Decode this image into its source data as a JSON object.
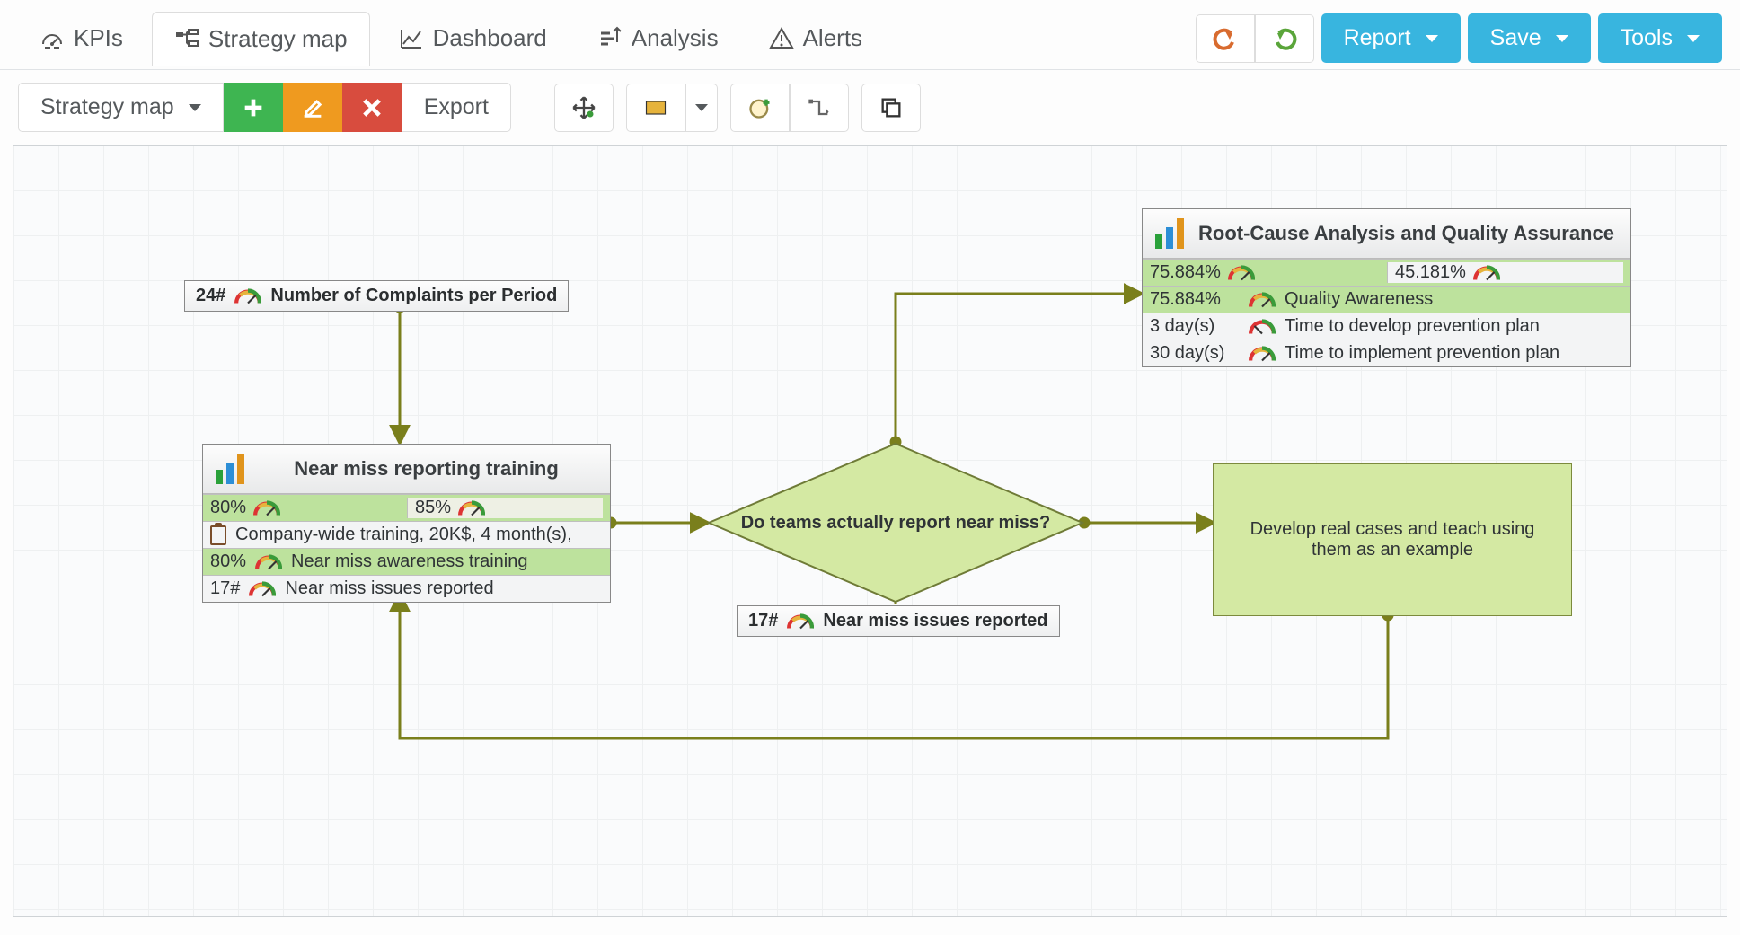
{
  "nav": {
    "tabs": {
      "kpis": "KPIs",
      "strategy_map": "Strategy map",
      "dashboard": "Dashboard",
      "analysis": "Analysis",
      "alerts": "Alerts"
    },
    "buttons": {
      "report": "Report",
      "save": "Save",
      "tools": "Tools"
    }
  },
  "toolbar": {
    "page_label": "Strategy map",
    "export": "Export"
  },
  "nodes": {
    "complaints_pill": {
      "value": "24#",
      "label": "Number of Complaints per Period"
    },
    "training_card": {
      "title": "Near miss reporting training",
      "metric_left": "80%",
      "metric_right": "85%",
      "initiative": "Company-wide training, 20K$, 4 month(s),",
      "row1_value": "80%",
      "row1_label": "Near miss awareness training",
      "row2_value": "17#",
      "row2_label": "Near miss issues reported"
    },
    "decision": {
      "label": "Do teams actually report near miss?"
    },
    "issues_pill": {
      "value": "17#",
      "label": "Near miss issues reported"
    },
    "rootcause_card": {
      "title": "Root-Cause Analysis and Quality Assurance",
      "metric_left": "75.884%",
      "metric_right": "45.181%",
      "row1_value": "75.884%",
      "row1_label": "Quality Awareness",
      "row2_value": "3 day(s)",
      "row2_label": "Time to develop prevention plan",
      "row3_value": "30 day(s)",
      "row3_label": "Time to implement prevention plan"
    },
    "develop_box": {
      "label": "Develop real cases and teach using them as an example"
    }
  },
  "colors": {
    "accent_blue": "#38b5df",
    "connector": "#7a7f1c"
  }
}
